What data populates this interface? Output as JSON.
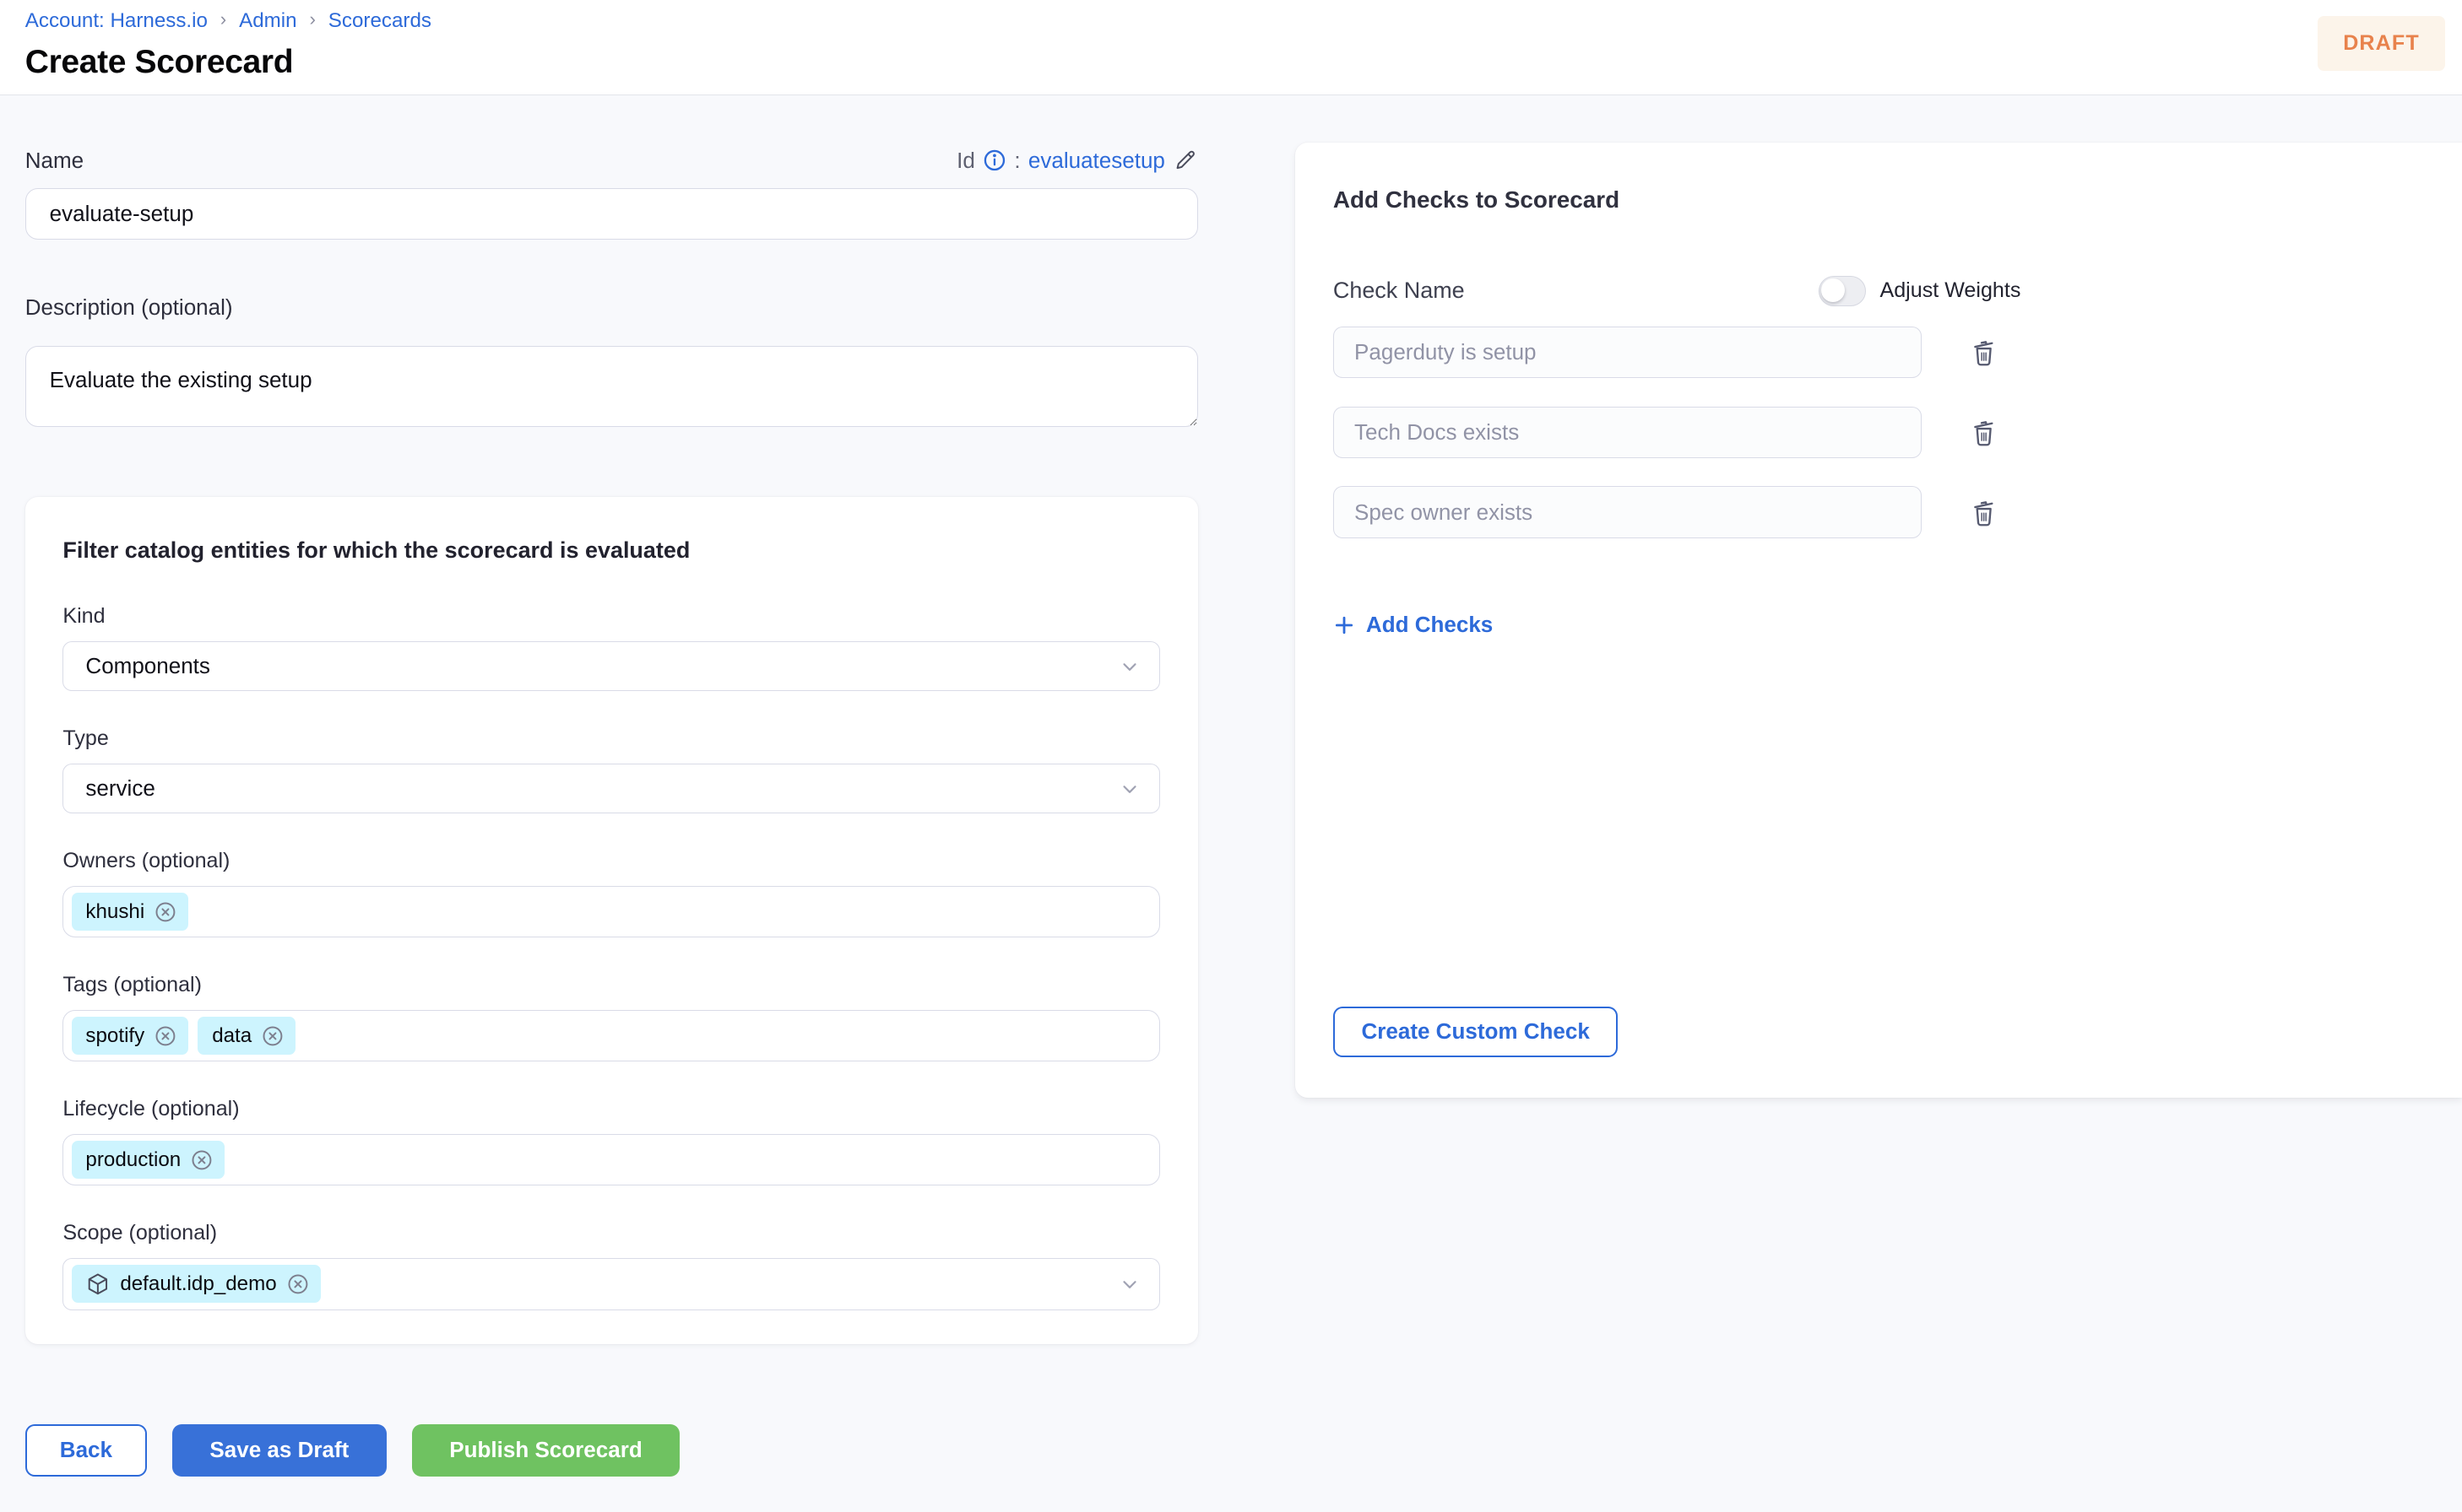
{
  "breadcrumb": {
    "items": [
      "Account: Harness.io",
      "Admin",
      "Scorecards"
    ],
    "separator": "›"
  },
  "page": {
    "title": "Create Scorecard",
    "status_badge": "DRAFT"
  },
  "form": {
    "name": {
      "label": "Name",
      "value": "evaluate-setup"
    },
    "id_row": {
      "label": "Id",
      "colon": ":",
      "value": "evaluatesetup"
    },
    "description": {
      "label": "Description (optional)",
      "value": "Evaluate the existing setup"
    },
    "filter": {
      "heading": "Filter catalog entities for which the scorecard is evaluated",
      "kind": {
        "label": "Kind",
        "value": "Components"
      },
      "type": {
        "label": "Type",
        "value": "service"
      },
      "owners": {
        "label": "Owners (optional)",
        "chips": [
          "khushi"
        ]
      },
      "tags": {
        "label": "Tags (optional)",
        "chips": [
          "spotify",
          "data"
        ]
      },
      "lifecycle": {
        "label": "Lifecycle (optional)",
        "chips": [
          "production"
        ]
      },
      "scope": {
        "label": "Scope (optional)",
        "chips": [
          "default.idp_demo"
        ]
      }
    }
  },
  "checks_panel": {
    "heading": "Add Checks to Scorecard",
    "column_label": "Check Name",
    "adjust_weights_label": "Adjust Weights",
    "checks": [
      "Pagerduty is setup",
      "Tech Docs exists",
      "Spec owner exists"
    ],
    "add_checks_label": "Add Checks",
    "create_custom_check_label": "Create Custom Check"
  },
  "footer": {
    "back_label": "Back",
    "save_draft_label": "Save as Draft",
    "publish_label": "Publish Scorecard"
  },
  "colors": {
    "primary_blue": "#2D6AD9",
    "button_blue": "#3871D8",
    "button_green": "#6FC261",
    "draft_text": "#E8824C",
    "draft_bg": "#FCF4EA",
    "chip_bg": "#CDF4FE",
    "page_bg": "#F8F9FC"
  }
}
